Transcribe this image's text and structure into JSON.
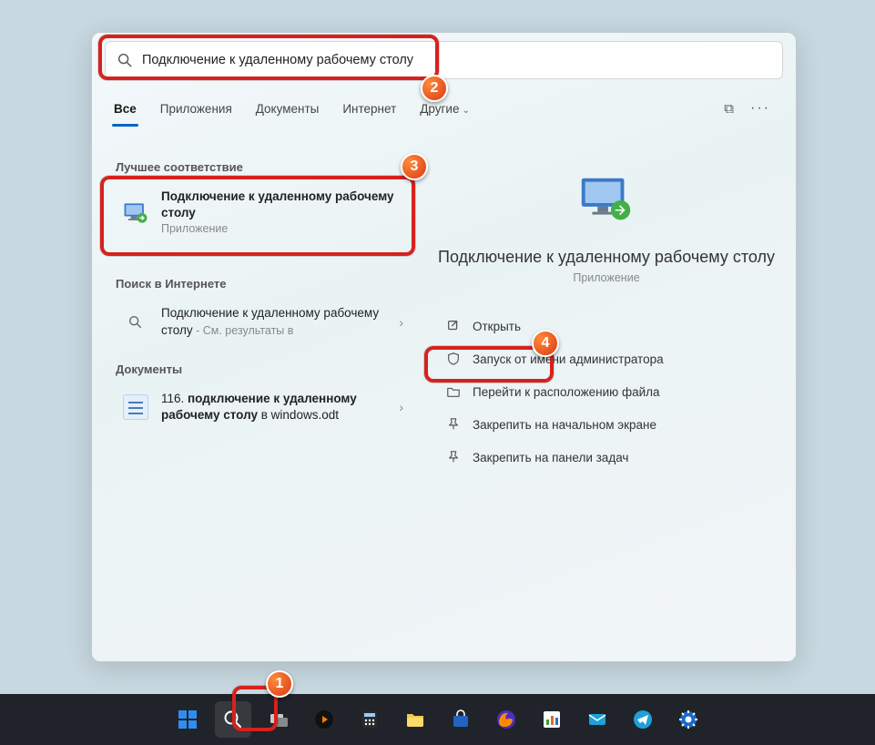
{
  "search": {
    "value": "Подключение к удаленному рабочему столу"
  },
  "filters": {
    "all": "Все",
    "apps": "Приложения",
    "docs": "Документы",
    "web": "Интернет",
    "more": "Другие"
  },
  "sections": {
    "best": "Лучшее соответствие",
    "web": "Поиск в Интернете",
    "docs": "Документы"
  },
  "bestMatch": {
    "title": "Подключение к удаленному рабочему столу",
    "sub": "Приложение"
  },
  "webResult": {
    "prefix": "Подключение к удаленному рабочему столу",
    "suffix": " - См. результаты в"
  },
  "docResult": {
    "prefix": "116. ",
    "bold": "подключение к удаленному рабочему столу",
    "suffix": " в windows.odt"
  },
  "detail": {
    "title": "Подключение к удаленному рабочему столу",
    "sub": "Приложение"
  },
  "actions": {
    "open": "Открыть",
    "runAdmin": "Запуск от имени администратора",
    "fileLoc": "Перейти к расположению файла",
    "pinStart": "Закрепить на начальном экране",
    "pinTask": "Закрепить на панели задач"
  },
  "badges": {
    "b1": "1",
    "b2": "2",
    "b3": "3",
    "b4": "4"
  }
}
